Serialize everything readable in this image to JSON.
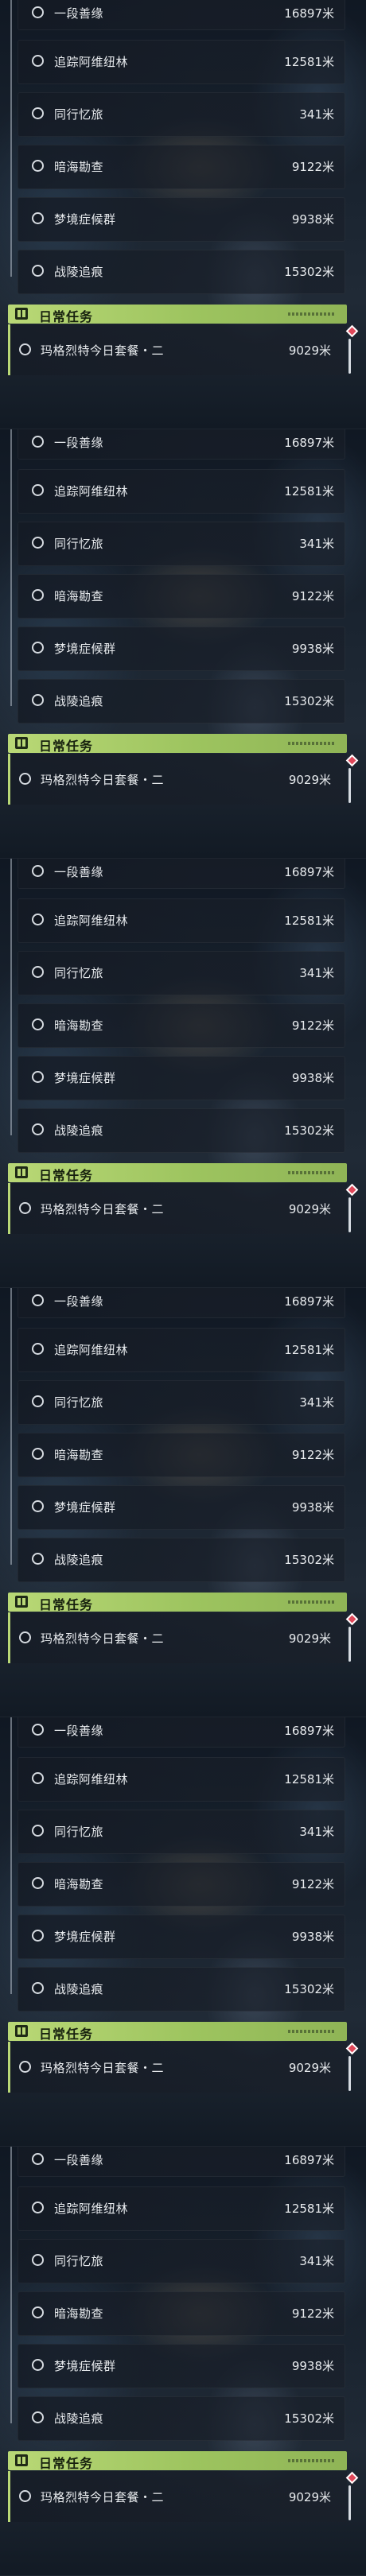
{
  "screens": [
    {
      "tasks": [
        {
          "name": "一段善缘",
          "distance": "16897米"
        },
        {
          "name": "追踪阿维纽林",
          "distance": "12581米"
        },
        {
          "name": "同行忆旅",
          "distance": "341米"
        },
        {
          "name": "暗海勘查",
          "distance": "9122米"
        },
        {
          "name": "梦境症候群",
          "distance": "9938米"
        },
        {
          "name": "战陵追痕",
          "distance": "15302米"
        }
      ],
      "daily": {
        "title": "日常任务",
        "task_name": "玛格烈特今日套餐・二",
        "distance": "9029米"
      }
    },
    {
      "tasks": [
        {
          "name": "一段善缘",
          "distance": "16897米"
        },
        {
          "name": "追踪阿维纽林",
          "distance": "12581米"
        },
        {
          "name": "同行忆旅",
          "distance": "341米"
        },
        {
          "name": "暗海勘查",
          "distance": "9122米"
        },
        {
          "name": "梦境症候群",
          "distance": "9938米"
        },
        {
          "name": "战陵追痕",
          "distance": "15302米"
        }
      ],
      "daily": {
        "title": "日常任务",
        "task_name": "玛格烈特今日套餐・二",
        "distance": "9029米"
      }
    },
    {
      "tasks": [
        {
          "name": "一段善缘",
          "distance": "16897米"
        },
        {
          "name": "追踪阿维纽林",
          "distance": "12581米"
        },
        {
          "name": "同行忆旅",
          "distance": "341米"
        },
        {
          "name": "暗海勘查",
          "distance": "9122米"
        },
        {
          "name": "梦境症候群",
          "distance": "9938米"
        },
        {
          "name": "战陵追痕",
          "distance": "15302米"
        }
      ],
      "daily": {
        "title": "日常任务",
        "task_name": "玛格烈特今日套餐・二",
        "distance": "9029米"
      }
    },
    {
      "tasks": [
        {
          "name": "一段善缘",
          "distance": "16897米"
        },
        {
          "name": "追踪阿维纽林",
          "distance": "12581米"
        },
        {
          "name": "同行忆旅",
          "distance": "341米"
        },
        {
          "name": "暗海勘查",
          "distance": "9122米"
        },
        {
          "name": "梦境症候群",
          "distance": "9938米"
        },
        {
          "name": "战陵追痕",
          "distance": "15302米"
        }
      ],
      "daily": {
        "title": "日常任务",
        "task_name": "玛格烈特今日套餐・二",
        "distance": "9029米"
      }
    },
    {
      "tasks": [
        {
          "name": "一段善缘",
          "distance": "16897米"
        },
        {
          "name": "追踪阿维纽林",
          "distance": "12581米"
        },
        {
          "name": "同行忆旅",
          "distance": "341米"
        },
        {
          "name": "暗海勘查",
          "distance": "9122米"
        },
        {
          "name": "梦境症候群",
          "distance": "9938米"
        },
        {
          "name": "战陵追痕",
          "distance": "15302米"
        }
      ],
      "daily": {
        "title": "日常任务",
        "task_name": "玛格烈特今日套餐・二",
        "distance": "9029米"
      }
    },
    {
      "tasks": [
        {
          "name": "一段善缘",
          "distance": "16897米"
        },
        {
          "name": "追踪阿维纽林",
          "distance": "12581米"
        },
        {
          "name": "同行忆旅",
          "distance": "341米"
        },
        {
          "name": "暗海勘查",
          "distance": "9122米"
        },
        {
          "name": "梦境症候群",
          "distance": "9938米"
        },
        {
          "name": "战陵追痕",
          "distance": "15302米"
        }
      ],
      "daily": {
        "title": "日常任务",
        "task_name": "玛格烈特今日套餐・二",
        "distance": "9029米"
      }
    }
  ],
  "icons": {
    "task_marker": "radio-circle-icon",
    "daily_header": "book-icon",
    "daily_alert": "alert-diamond-icon"
  },
  "colors": {
    "accent_green": "#b9d876",
    "alert_red": "#e0485a",
    "text": "#e8ebee"
  }
}
